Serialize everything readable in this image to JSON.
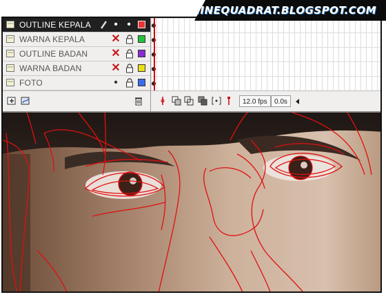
{
  "banner": {
    "text": "NINEQUADRAT.BLOGSPOT.COM"
  },
  "layers": [
    {
      "name": "OUTLINE KEPALA",
      "selected": true,
      "visibility": "dot",
      "color": "#ee3333"
    },
    {
      "name": "WARNA KEPALA",
      "selected": false,
      "visibility": "hidden",
      "color": "#22c33a"
    },
    {
      "name": "OUTLINE BADAN",
      "selected": false,
      "visibility": "hidden",
      "color": "#8a2bd6"
    },
    {
      "name": "WARNA BADAN",
      "selected": false,
      "visibility": "hidden",
      "color": "#ecdf16"
    },
    {
      "name": "FOTO",
      "selected": false,
      "visibility": "dot",
      "color": "#3a6ee8"
    }
  ],
  "status": {
    "fps": "12.0 fps",
    "time": "0.0s"
  }
}
